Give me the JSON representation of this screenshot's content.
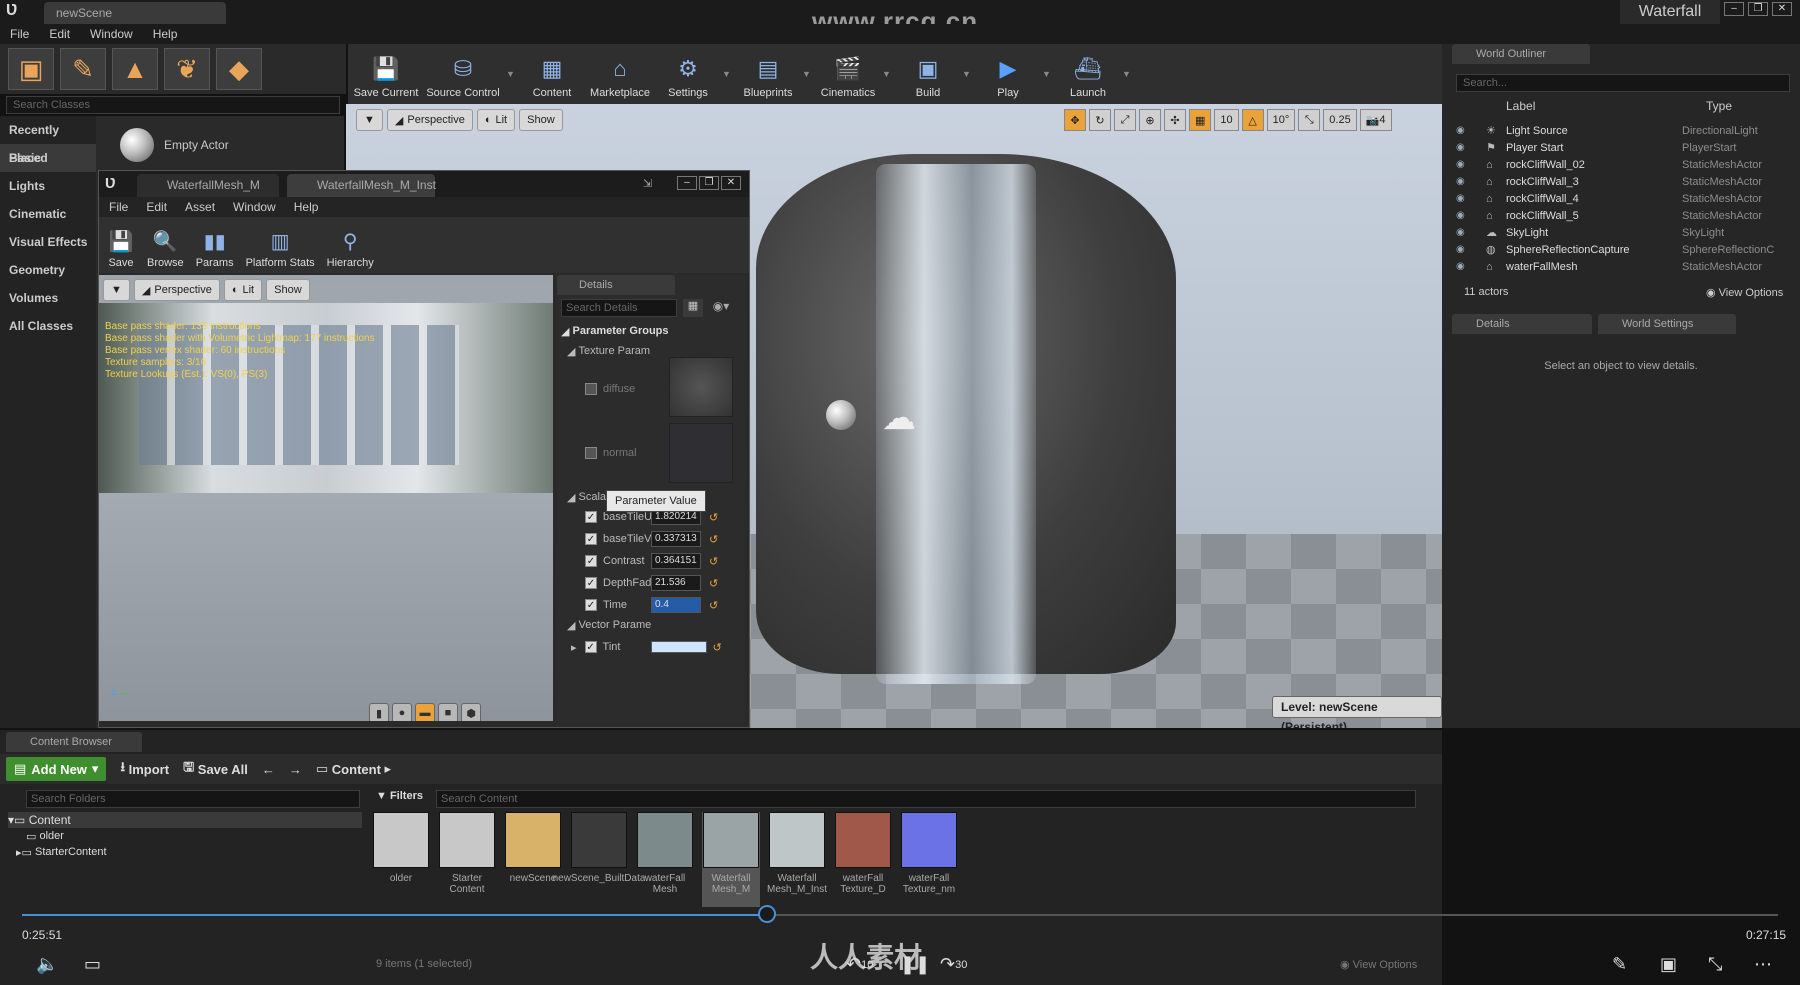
{
  "window": {
    "tab_title": "newScene",
    "watermark": "www.rrcg.cn",
    "project": "Waterfall",
    "controls": [
      "–",
      "❐",
      "✕"
    ]
  },
  "menu": [
    "File",
    "Edit",
    "Window",
    "Help"
  ],
  "modes": {
    "search_placeholder": "Search Classes",
    "categories": [
      "Recently Placed",
      "Basic",
      "Lights",
      "Cinematic",
      "Visual Effects",
      "Geometry",
      "Volumes",
      "All Classes"
    ],
    "empty_actor": "Empty Actor"
  },
  "toolbar": [
    {
      "label": "Save Current",
      "icon": "save-icon"
    },
    {
      "label": "Source Control",
      "icon": "source-control-icon"
    },
    {
      "label": "Content",
      "icon": "content-icon"
    },
    {
      "label": "Marketplace",
      "icon": "marketplace-icon"
    },
    {
      "label": "Settings",
      "icon": "settings-icon"
    },
    {
      "label": "Blueprints",
      "icon": "blueprints-icon"
    },
    {
      "label": "Cinematics",
      "icon": "cinematics-icon"
    },
    {
      "label": "Build",
      "icon": "build-icon"
    },
    {
      "label": "Play",
      "icon": "play-icon"
    },
    {
      "label": "Launch",
      "icon": "launch-icon"
    }
  ],
  "viewport": {
    "perspective": "Perspective",
    "lit": "Lit",
    "show": "Show",
    "snap_grid": "10",
    "snap_rot": "10°",
    "snap_scale": "0.25",
    "camera_speed": "4",
    "level": "Level:  newScene (Persistent)"
  },
  "material_editor": {
    "tabs": [
      "WaterfallMesh_M",
      "WaterfallMesh_M_Inst"
    ],
    "menu": [
      "File",
      "Edit",
      "Asset",
      "Window",
      "Help"
    ],
    "toolbar": [
      "Save",
      "Browse",
      "Params",
      "Platform Stats",
      "Hierarchy"
    ],
    "viewport": {
      "perspective": "Perspective",
      "lit": "Lit",
      "show": "Show"
    },
    "stats": [
      "Base pass shader: 133 instructions",
      "Base pass shader with Volumetric Lightmap: 177 instructions",
      "Base pass vertex shader: 60 instructions",
      "Texture samplers: 3/16",
      "Texture Lookups (Est.): VS(0), PS(3)"
    ],
    "details": {
      "tab": "Details",
      "search_placeholder": "Search Details",
      "parameter_groups": "Parameter Groups",
      "texture_params": "Texture Param",
      "textures": [
        "diffuse",
        "normal"
      ],
      "scalar_params": "Scalar Parame",
      "scalars": [
        {
          "name": "baseTileU",
          "value": "1.820214"
        },
        {
          "name": "baseTileV",
          "value": "0.337313"
        },
        {
          "name": "Contrast",
          "value": "0.364151"
        },
        {
          "name": "DepthFade",
          "value": "21.536"
        },
        {
          "name": "Time",
          "value": "0.4"
        }
      ],
      "vector_params": "Vector Parame",
      "vector_tint": "Tint",
      "tooltip": "Parameter Value"
    }
  },
  "outliner": {
    "tab": "World Outliner",
    "search_placeholder": "Search...",
    "col_label": "Label",
    "col_type": "Type",
    "rows": [
      {
        "label": "Light Source",
        "type": "DirectionalLight"
      },
      {
        "label": "Player Start",
        "type": "PlayerStart"
      },
      {
        "label": "rockCliffWall_02",
        "type": "StaticMeshActor"
      },
      {
        "label": "rockCliffWall_3",
        "type": "StaticMeshActor"
      },
      {
        "label": "rockCliffWall_4",
        "type": "StaticMeshActor"
      },
      {
        "label": "rockCliffWall_5",
        "type": "StaticMeshActor"
      },
      {
        "label": "SkyLight",
        "type": "SkyLight"
      },
      {
        "label": "SphereReflectionCapture",
        "type": "SphereReflectionC"
      },
      {
        "label": "waterFallMesh",
        "type": "StaticMeshActor"
      }
    ],
    "actor_count": "11 actors",
    "view_options": "View Options"
  },
  "details": {
    "tabs": [
      "Details",
      "World Settings"
    ],
    "empty_message": "Select an object to view details."
  },
  "content_browser": {
    "tab": "Content Browser",
    "add_new": "Add New",
    "import": "Import",
    "save_all": "Save All",
    "path": "Content",
    "folder_search_placeholder": "Search Folders",
    "filters": "Filters",
    "content_search_placeholder": "Search Content",
    "tree": [
      "Content",
      "older",
      "StarterContent"
    ],
    "assets": [
      {
        "name": "older",
        "color": "#c8c8c8"
      },
      {
        "name": "Starter Content",
        "color": "#c8c8c8"
      },
      {
        "name": "newScene",
        "color": "#d9b26a"
      },
      {
        "name": "newScene_BuiltData",
        "color": "#3a3a3a"
      },
      {
        "name": "waterFall Mesh",
        "color": "#7d8a8c"
      },
      {
        "name": "Waterfall Mesh_M",
        "color": "#9aa3a5"
      },
      {
        "name": "Waterfall Mesh_M_Inst",
        "color": "#bfc6c8"
      },
      {
        "name": "waterFall Texture_D",
        "color": "#a0584a"
      },
      {
        "name": "waterFall Texture_nm",
        "color": "#6a72e6"
      }
    ],
    "items_count": "9 items (1 selected)",
    "view_options": "View Options"
  },
  "player": {
    "time_current": "0:25:51",
    "time_total": "0:27:15",
    "progress": 0.424,
    "skip_back": "10",
    "skip_forward": "30",
    "logo": "人人素材"
  }
}
